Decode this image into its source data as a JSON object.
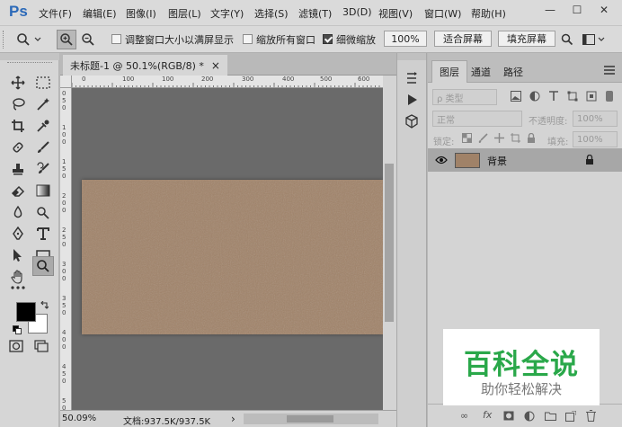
{
  "app": {
    "logo": "Ps"
  },
  "menu": [
    "文件(F)",
    "编辑(E)",
    "图像(I)",
    "图层(L)",
    "文字(Y)",
    "选择(S)",
    "滤镜(T)",
    "3D(D)",
    "视图(V)",
    "窗口(W)",
    "帮助(H)"
  ],
  "window_controls": {
    "minimize": "—",
    "maximize": "☐",
    "close": "✕"
  },
  "options": {
    "zoom_icon": "magnifier-icon",
    "checkbox1_label": "调整窗口大小以满屏显示",
    "checkbox1_checked": false,
    "checkbox2_label": "缩放所有窗口",
    "checkbox2_checked": false,
    "checkbox3_label": "细微缩放",
    "checkbox3_checked": true,
    "zoom_value": "100%",
    "fit_screen": "适合屏幕",
    "fill_screen": "填充屏幕"
  },
  "document": {
    "tab_title": "未标题-1 @ 50.1%(RGB/8) *",
    "tab_close": "×",
    "hruler_ticks": [
      "100",
      "0",
      "100",
      "200",
      "300",
      "400",
      "500",
      "600",
      "700"
    ],
    "vruler_ticks": [
      "0",
      "5",
      "0",
      "1",
      "0",
      "0",
      "1",
      "5",
      "0",
      "2",
      "0",
      "0",
      "2",
      "5",
      "0",
      "3",
      "0",
      "0",
      "3",
      "5",
      "0",
      "4",
      "0",
      "0",
      "4",
      "5",
      "0",
      "5",
      "0",
      "0"
    ],
    "zoom_status": "50.09%",
    "doc_status": "文档:937.5K/937.5K",
    "status_arrow": "›"
  },
  "layers_panel": {
    "tabs": [
      "图层",
      "通道",
      "路径"
    ],
    "kind_filter": "ρ 类型",
    "blend_mode": "正常",
    "opacity_label": "不透明度:",
    "opacity_value": "100%",
    "lock_label": "锁定:",
    "fill_label": "填充:",
    "fill_value": "100%",
    "layer_name": "背景",
    "layer_color": "#a08268"
  },
  "bottom_icons": [
    "link-icon",
    "fx-icon",
    "mask-icon",
    "adjustment-icon",
    "group-icon",
    "new-layer-icon",
    "trash-icon"
  ],
  "bottom_labels": {
    "link": "∞",
    "fx": "fx"
  },
  "watermark": {
    "title": "百科全说",
    "subtitle": "助你轻松解决",
    "color": "#2aa84a"
  },
  "colors": {
    "foreground": "#000000",
    "background": "#ffffff"
  }
}
